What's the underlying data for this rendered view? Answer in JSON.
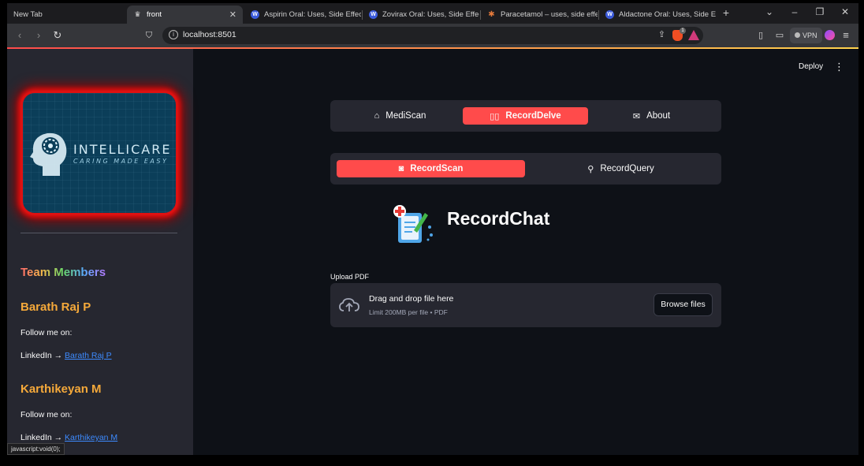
{
  "browser": {
    "tabs": [
      {
        "title": "New Tab"
      },
      {
        "title": "front",
        "close": "✕"
      },
      {
        "title": "Aspirin Oral: Uses, Side Effects, I"
      },
      {
        "title": "Zovirax Oral: Uses, Side Effects, I"
      },
      {
        "title": "Paracetamol – uses, side effects"
      },
      {
        "title": "Aldactone Oral: Uses, Side Effec"
      }
    ],
    "new_tab": "+",
    "url": "localhost:8501",
    "vpn_label": "VPN",
    "brave_badge": "1",
    "status_url": "javascript:void(0);"
  },
  "sidebar": {
    "logo": {
      "title": "INTELLICARE",
      "tagline": "CARING MADE EASY"
    },
    "team_title": "Team Members",
    "members": [
      {
        "name": "Barath Raj P",
        "follow": "Follow me on:",
        "linkedin_prefix": "LinkedIn → ",
        "linkedin_link": "Barath Raj P"
      },
      {
        "name": "Karthikeyan M",
        "follow": "Follow me on:",
        "linkedin_prefix": "LinkedIn → ",
        "linkedin_link": "Karthikeyan M"
      }
    ]
  },
  "header": {
    "deploy": "Deploy",
    "menu": "⋮"
  },
  "nav": {
    "items": [
      {
        "label": "MediScan",
        "icon": "home-icon",
        "selected": false
      },
      {
        "label": "RecordDelve",
        "icon": "book-icon",
        "selected": true
      },
      {
        "label": "About",
        "icon": "envelope-icon",
        "selected": false
      }
    ]
  },
  "subnav": {
    "items": [
      {
        "label": "RecordScan",
        "icon": "camera-icon",
        "selected": true
      },
      {
        "label": "RecordQuery",
        "icon": "search-icon",
        "selected": false
      }
    ]
  },
  "main": {
    "title": "RecordChat",
    "upload": {
      "label": "Upload PDF",
      "drag_text": "Drag and drop file here",
      "limit_text": "Limit 200MB per file • PDF",
      "browse_label": "Browse files"
    }
  },
  "colors": {
    "accent": "#ff4b4b",
    "member_name": "#f5a93a",
    "link": "#3d8bff",
    "sidebar_bg": "#262730",
    "page_bg": "#0e1117"
  }
}
